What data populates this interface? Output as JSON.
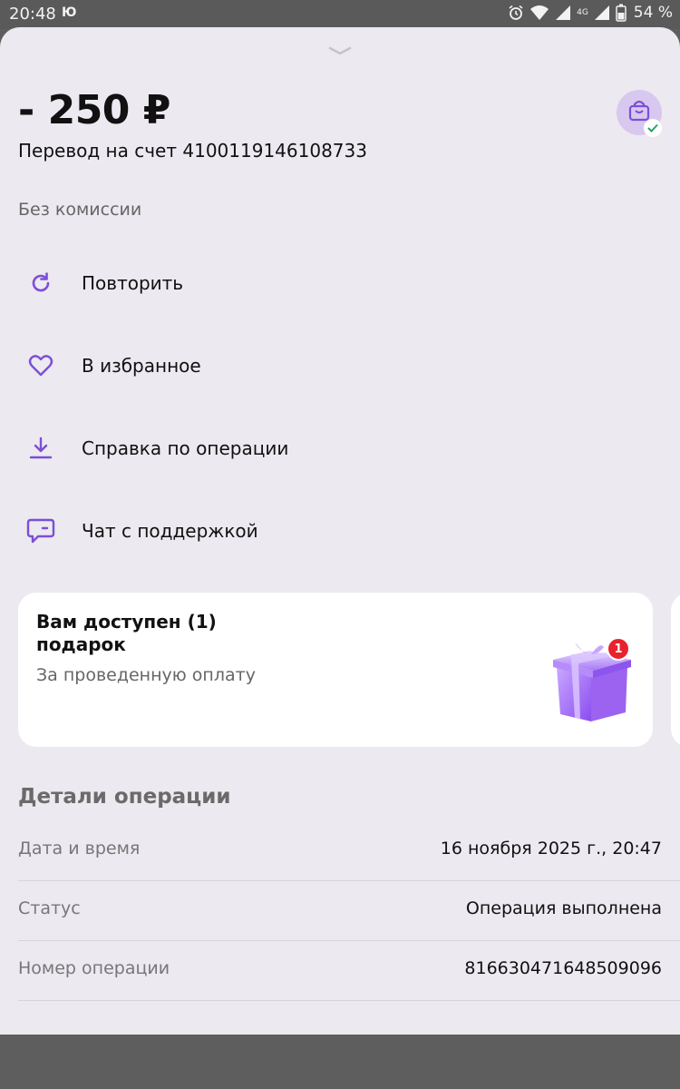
{
  "status_bar": {
    "time": "20:48",
    "app_glyph": "Ю",
    "network_label": "4G",
    "battery": "54 %"
  },
  "transaction": {
    "amount": "- 250 ₽",
    "description": "Перевод на счет 4100119146108733",
    "fee_note": "Без комиссии"
  },
  "actions": [
    {
      "label": "Повторить",
      "icon": "repeat-icon"
    },
    {
      "label": "В избранное",
      "icon": "heart-icon"
    },
    {
      "label": "Справка по операции",
      "icon": "download-icon"
    },
    {
      "label": "Чат с поддержкой",
      "icon": "chat-icon"
    }
  ],
  "gift": {
    "title": "Вам доступен (1) подарок",
    "description": "За проведенную оплату",
    "badge_count": "1"
  },
  "details": {
    "title": "Детали операции",
    "rows": [
      {
        "label": "Дата и время",
        "value": "16 ноября 2025 г., 20:47"
      },
      {
        "label": "Статус",
        "value": "Операция выполнена"
      },
      {
        "label": "Номер операции",
        "value": "816630471648509096"
      }
    ]
  },
  "colors": {
    "accent": "#7b4fd8",
    "sheet_background": "#ece9f0",
    "badge": "#e8222e",
    "success": "#2aa36b"
  }
}
